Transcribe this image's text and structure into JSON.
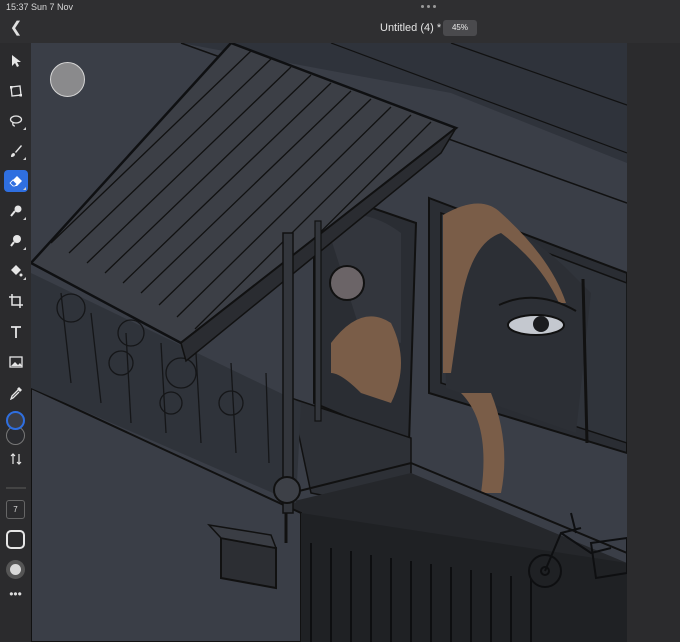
{
  "status": {
    "time": "15:37",
    "date": "Sun 7 Nov"
  },
  "header": {
    "title": "Untitled (4) *",
    "zoom": "45%"
  },
  "toolbar": {
    "tools": [
      {
        "name": "selection-tool",
        "icon": "arrow-icon"
      },
      {
        "name": "transform-tool",
        "icon": "transform-icon"
      },
      {
        "name": "lasso-tool",
        "icon": "lasso-icon"
      },
      {
        "name": "brush-tool",
        "icon": "brush-icon"
      },
      {
        "name": "eraser-tool",
        "icon": "eraser-icon",
        "active": true
      },
      {
        "name": "smudge-tool",
        "icon": "smudge-icon"
      },
      {
        "name": "clone-tool",
        "icon": "clone-icon"
      },
      {
        "name": "fill-tool",
        "icon": "fill-icon"
      },
      {
        "name": "crop-tool",
        "icon": "crop-icon"
      },
      {
        "name": "text-tool",
        "icon": "text-icon"
      },
      {
        "name": "image-tool",
        "icon": "image-icon"
      },
      {
        "name": "eyedropper-tool",
        "icon": "eyedropper-icon"
      }
    ],
    "foreground_color": "#3b3d44",
    "background_color": "#2a2b2f",
    "brush_size": "7"
  },
  "colors": {
    "accent": "#2f6fe0",
    "wall": "#3a3e47",
    "hair": "#8a6a52",
    "canvas_dark": "#25272b"
  }
}
